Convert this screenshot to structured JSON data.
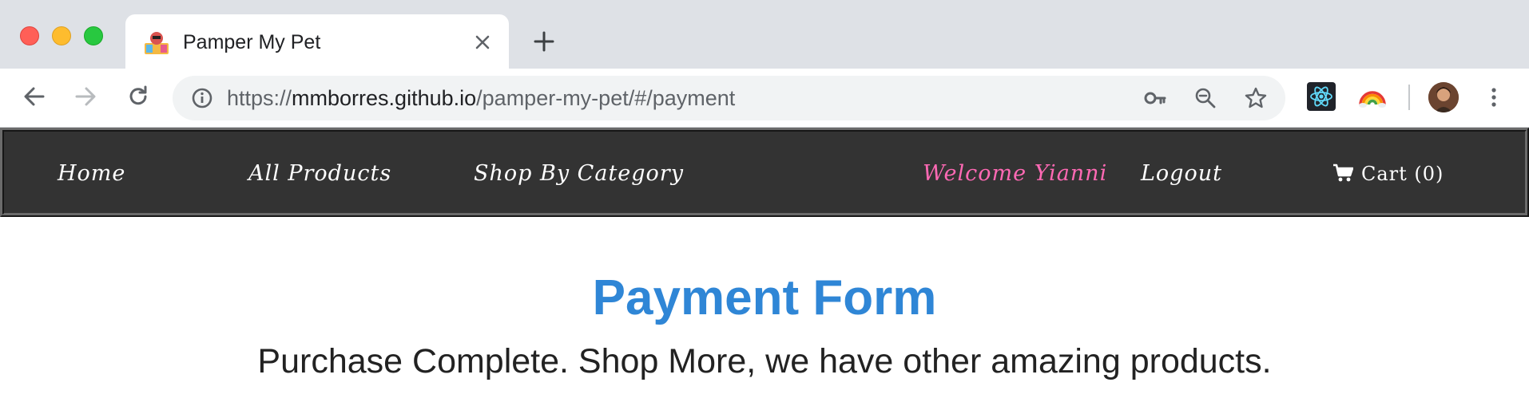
{
  "browser": {
    "tab": {
      "title": "Pamper My Pet",
      "favicon": "pet-favicon-icon"
    },
    "url": {
      "scheme": "https://",
      "host": "mmborres.github.io",
      "path": "/pamper-my-pet/#/payment"
    },
    "icons": {
      "back": "back-arrow-icon",
      "forward": "forward-arrow-icon",
      "reload": "reload-icon",
      "info": "info-icon",
      "key": "key-icon",
      "zoom": "zoom-out-icon",
      "star": "star-icon",
      "react_extension": "react-icon",
      "rainbow_extension": "rainbow-icon",
      "menu": "more-vert-icon"
    }
  },
  "navbar": {
    "home": "Home",
    "all_products": "All Products",
    "shop_by_category": "Shop By Category",
    "welcome": "Welcome Yianni",
    "logout": "Logout",
    "cart": "Cart (0)"
  },
  "main": {
    "title": "Payment Form",
    "message": "Purchase Complete. Shop More, we have other amazing products."
  },
  "colors": {
    "navbar_bg": "#333333",
    "welcome_text": "#ff69b4",
    "title_text": "#2f86d6",
    "message_text": "#222222"
  }
}
